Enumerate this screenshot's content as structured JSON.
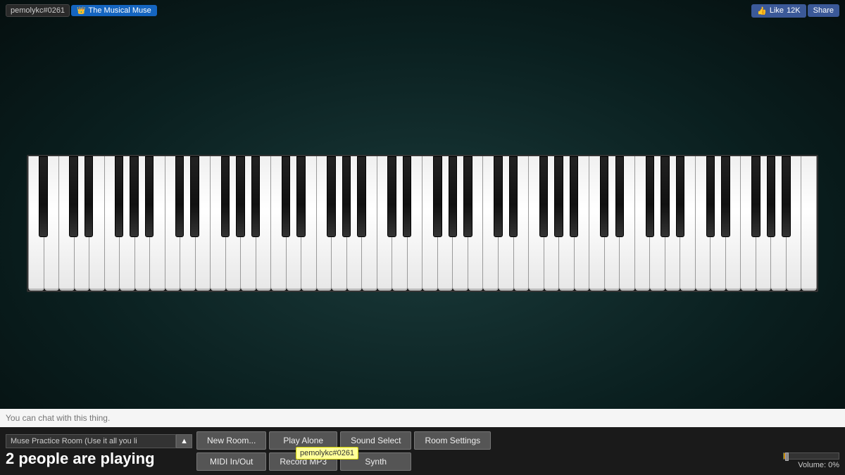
{
  "header": {
    "username": "pemolykc#0261",
    "channel_name": "The Musical Muse",
    "fb_like_label": "Like",
    "fb_like_count": "12K",
    "fb_share_label": "Share"
  },
  "piano": {
    "white_key_count": 52,
    "octaves": 7
  },
  "chat": {
    "input_placeholder": "You can chat with this thing.",
    "tooltip_text": "pemolykc#0261"
  },
  "toolbar": {
    "room_name": "Muse Practice Room (Use it all you li",
    "players_label": "2 people are playing",
    "players_count": "2",
    "buttons": [
      {
        "id": "new-room",
        "label": "New Room...",
        "row": 1,
        "col": 1
      },
      {
        "id": "play-alone",
        "label": "Play Alone",
        "row": 1,
        "col": 2
      },
      {
        "id": "sound-select",
        "label": "Sound Select",
        "row": 1,
        "col": 3
      },
      {
        "id": "room-settings",
        "label": "Room Settings",
        "row": 1,
        "col": 4
      },
      {
        "id": "midi-inout",
        "label": "MIDI In/Out",
        "row": 2,
        "col": 1
      },
      {
        "id": "record-mp3",
        "label": "Record MP3",
        "row": 2,
        "col": 2
      },
      {
        "id": "synth",
        "label": "Synth",
        "row": 2,
        "col": 3
      }
    ],
    "volume_label": "Volume: 0%"
  }
}
